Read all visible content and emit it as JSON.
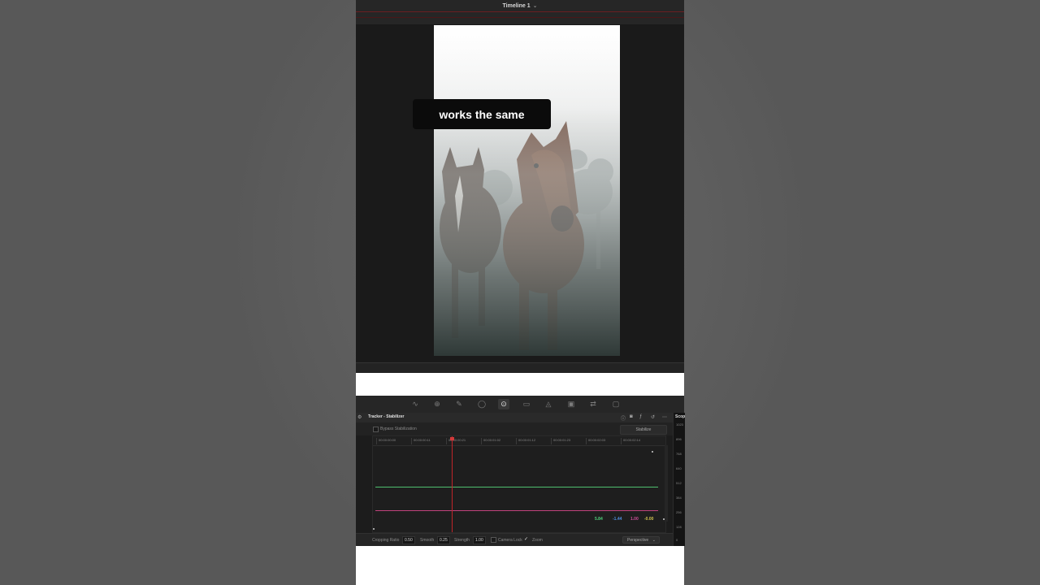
{
  "viewer": {
    "timeline_title": "Timeline 1",
    "caption": "works the same"
  },
  "toolbar": {
    "tools": [
      {
        "name": "curves-icon",
        "glyph": "∿"
      },
      {
        "name": "qualifier-icon",
        "glyph": "⊕"
      },
      {
        "name": "eyedropper-icon",
        "glyph": "✎"
      },
      {
        "name": "window-icon",
        "glyph": "◯"
      },
      {
        "name": "tracker-icon",
        "glyph": "⊙",
        "active": true
      },
      {
        "name": "magic-mask-icon",
        "glyph": "▭"
      },
      {
        "name": "blur-icon",
        "glyph": "◬"
      },
      {
        "name": "key-icon",
        "glyph": "▣"
      },
      {
        "name": "sizing-icon",
        "glyph": "⇄"
      },
      {
        "name": "3d-icon",
        "glyph": "▢"
      }
    ]
  },
  "tracker": {
    "title": "Tracker - Stabilizer",
    "bypass_label": "Bypass Stabilization",
    "stabilize_label": "Stabilize",
    "timecodes": [
      "00:00:00:00",
      "00:00:00:11",
      "00:00:00:21",
      "00:00:01:02",
      "00:00:01:12",
      "00:00:01:23",
      "00:00:02:03",
      "00:00:02:14"
    ],
    "readouts": [
      {
        "value": "5.84",
        "color": "#4fd07a"
      },
      {
        "value": "-1.44",
        "color": "#4f8fe0"
      },
      {
        "value": "1.00",
        "color": "#d04f9a"
      },
      {
        "value": "-0.00",
        "color": "#d0c24f"
      }
    ],
    "cropping_ratio_label": "Cropping Ratio",
    "cropping_ratio_value": "0.50",
    "smooth_label": "Smooth",
    "smooth_value": "0.25",
    "strength_label": "Strength",
    "strength_value": "1.00",
    "camera_lock_label": "Camera Lock",
    "zoom_label": "Zoom",
    "mode_value": "Perspective"
  },
  "scopes": {
    "label": "Scop",
    "values": [
      "1023",
      "896",
      "768",
      "640",
      "512",
      "384",
      "256",
      "128",
      "0"
    ]
  }
}
